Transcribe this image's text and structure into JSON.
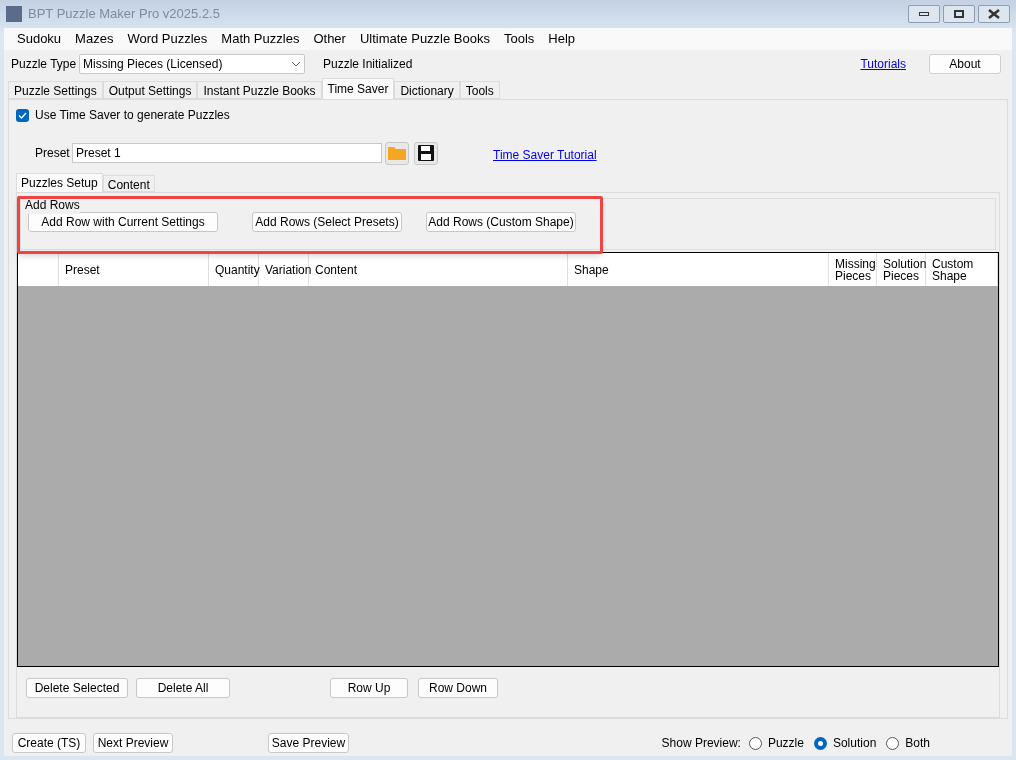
{
  "window": {
    "title": "BPT Puzzle Maker Pro v2025.2.5"
  },
  "menu": [
    "Sudoku",
    "Mazes",
    "Word Puzzles",
    "Math Puzzles",
    "Other",
    "Ultimate Puzzle Books",
    "Tools",
    "Help"
  ],
  "puzzle_type": {
    "label": "Puzzle Type",
    "value": "Missing Pieces (Licensed)",
    "status": "Puzzle Initialized"
  },
  "tutorials_link": "Tutorials",
  "about_button": "About",
  "tabs": [
    {
      "label": "Puzzle Settings",
      "selected": false
    },
    {
      "label": "Output Settings",
      "selected": false
    },
    {
      "label": "Instant Puzzle Books",
      "selected": false
    },
    {
      "label": "Time Saver",
      "selected": true
    },
    {
      "label": "Dictionary",
      "selected": false
    },
    {
      "label": "Tools",
      "selected": false
    }
  ],
  "use_time_saver": {
    "label": "Use Time Saver to generate Puzzles",
    "checked": true
  },
  "preset": {
    "label": "Preset",
    "value": "Preset 1"
  },
  "time_saver_tutorial": "Time Saver Tutorial",
  "sub_tabs": [
    {
      "label": "Puzzles Setup",
      "selected": true
    },
    {
      "label": "Content",
      "selected": false
    }
  ],
  "add_rows": {
    "title": "Add Rows",
    "buttons": [
      "Add Row with Current Settings",
      "Add Rows (Select Presets)",
      "Add Rows (Custom Shape)"
    ]
  },
  "table": {
    "columns": [
      "Preset",
      "Quantity",
      "Variation",
      "Content",
      "Shape",
      "Missing\nPieces",
      "Solution\nPieces",
      "Custom\nShape"
    ]
  },
  "row_buttons": [
    "Delete Selected",
    "Delete All",
    "Row Up",
    "Row Down"
  ],
  "bottom_buttons": [
    "Create (TS)",
    "Next Preview",
    "Save Preview"
  ],
  "show_preview": {
    "label": "Show Preview:",
    "options": [
      {
        "label": "Puzzle",
        "selected": false
      },
      {
        "label": "Solution",
        "selected": true
      },
      {
        "label": "Both",
        "selected": false
      }
    ]
  }
}
